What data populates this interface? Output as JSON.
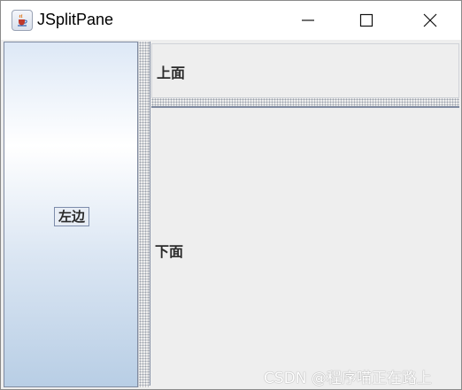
{
  "window": {
    "title": "JSplitPane",
    "app_icon": "java-cup-icon",
    "controls": [
      "minimize-icon",
      "maximize-icon",
      "close-icon"
    ]
  },
  "split_pane": {
    "left_button_label": "左边",
    "top_label": "上面",
    "bottom_label": "下面"
  },
  "watermark": "CSDN @程序喵正在路上",
  "colors": {
    "left_pane_gradient": [
      "#dde8f6",
      "#ffffff",
      "#b8cee5"
    ],
    "pane_border": "#7f8aa0",
    "background": "#eeeeee"
  }
}
